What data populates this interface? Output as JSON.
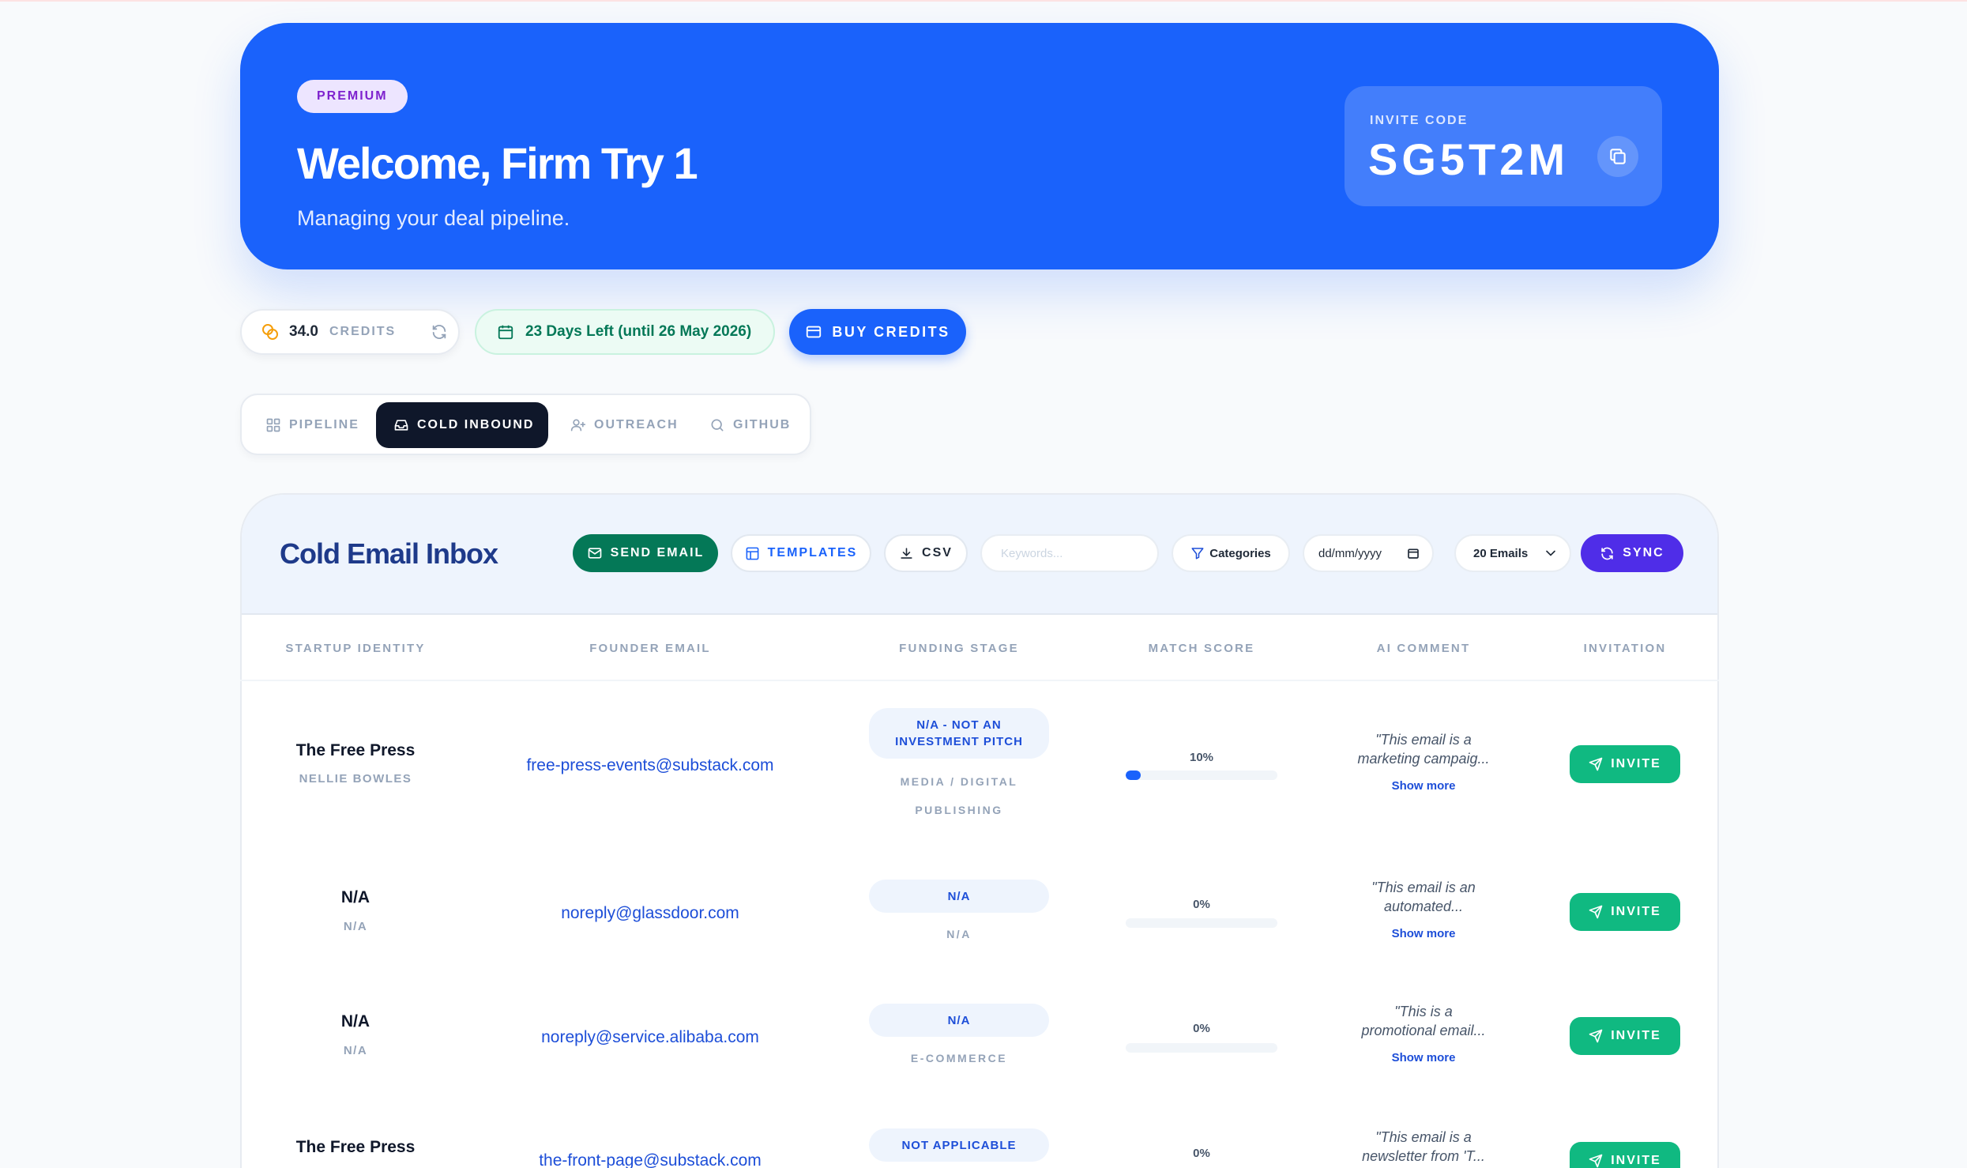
{
  "hero": {
    "badge": "PREMIUM",
    "title": "Welcome, Firm Try 1",
    "subtitle": "Managing your deal pipeline.",
    "invite_label": "INVITE CODE",
    "invite_code": "SG5T2M"
  },
  "stats": {
    "credits_value": "34.0",
    "credits_unit": "CREDITS",
    "days_left": "23 Days Left (until 26 May 2026)",
    "buy_label": "BUY CREDITS"
  },
  "tabs": [
    {
      "label": "PIPELINE",
      "icon": "grid-icon",
      "active": false
    },
    {
      "label": "COLD INBOUND",
      "icon": "inbox-icon",
      "active": true
    },
    {
      "label": "OUTREACH",
      "icon": "user-plus-icon",
      "active": false
    },
    {
      "label": "GITHUB",
      "icon": "search-icon",
      "active": false
    }
  ],
  "inbox": {
    "title": "Cold Email Inbox",
    "send_label": "SEND EMAIL",
    "templates_label": "TEMPLATES",
    "csv_label": "CSV",
    "search_placeholder": "Keywords...",
    "categories_label": "Categories",
    "date_placeholder": "dd/mm/yyyy",
    "emails_select": "20 Emails",
    "sync_label": "SYNC"
  },
  "columns": [
    "STARTUP IDENTITY",
    "FOUNDER EMAIL",
    "FUNDING STAGE",
    "MATCH SCORE",
    "AI COMMENT",
    "INVITATION"
  ],
  "rows": [
    {
      "startup": "The Free Press",
      "founder": "NELLIE BOWLES",
      "email": "free-press-events@substack.com",
      "stage_l1": "N/A - NOT AN",
      "stage_l2": "INVESTMENT PITCH",
      "category_l1": "MEDIA / DIGITAL",
      "category_l2": "PUBLISHING",
      "score_label": "10%",
      "score": 0.1,
      "comment_l1": "\"This email is a",
      "comment_l2": "marketing campaig...",
      "more": "Show more",
      "invite": "INVITE"
    },
    {
      "startup": "N/A",
      "founder": "N/A",
      "email": "noreply@glassdoor.com",
      "stage_l1": "N/A",
      "stage_l2": "",
      "category_l1": "N/A",
      "category_l2": "",
      "score_label": "0%",
      "score": 0,
      "comment_l1": "\"This email is an",
      "comment_l2": "automated...",
      "more": "Show more",
      "invite": "INVITE"
    },
    {
      "startup": "N/A",
      "founder": "N/A",
      "email": "noreply@service.alibaba.com",
      "stage_l1": "N/A",
      "stage_l2": "",
      "category_l1": "E-COMMERCE",
      "category_l2": "",
      "score_label": "0%",
      "score": 0,
      "comment_l1": "\"This is a",
      "comment_l2": "promotional email...",
      "more": "Show more",
      "invite": "INVITE"
    },
    {
      "startup": "The Free Press",
      "founder": "",
      "email": "the-front-page@substack.com",
      "stage_l1": "NOT APPLICABLE",
      "stage_l2": "",
      "category_l1": "",
      "category_l2": "",
      "score_label": "0%",
      "score": 0,
      "comment_l1": "\"This email is a",
      "comment_l2": "newsletter from 'T...",
      "more": "",
      "invite": "INVITE"
    }
  ],
  "colors": {
    "brand": "#1a62fb",
    "success": "#10b981",
    "sync": "#4f2de8",
    "dark": "#0f172a"
  }
}
